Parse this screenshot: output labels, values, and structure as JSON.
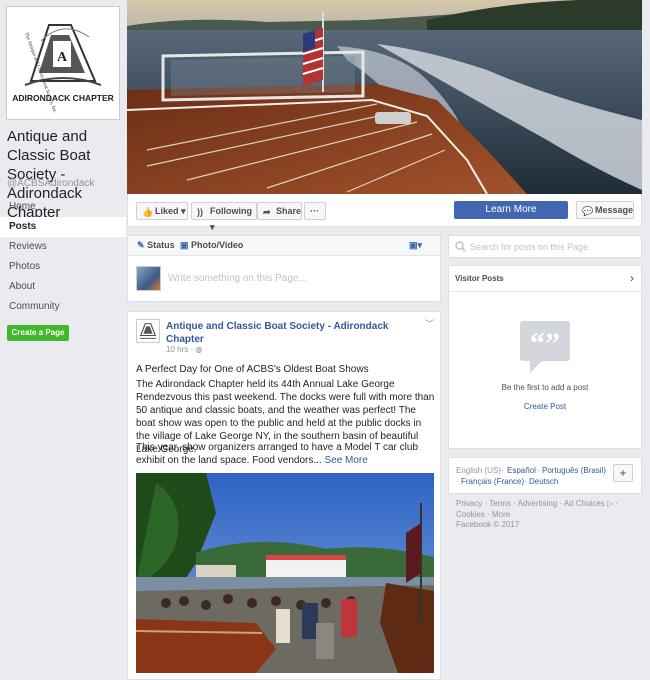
{
  "page": {
    "name": "Antique and Classic Boat Society - Adirondack Chapter",
    "handle": "@ACBSAdirondack",
    "logo_text_top": "The Antique and Classic Boat Society, Inc.",
    "logo_text_bottom": "ADIRONDACK CHAPTER"
  },
  "nav": {
    "items": [
      {
        "label": "Home"
      },
      {
        "label": "Posts"
      },
      {
        "label": "Reviews"
      },
      {
        "label": "Photos"
      },
      {
        "label": "About"
      },
      {
        "label": "Community"
      }
    ],
    "active": "Posts",
    "create_page": "Create a Page"
  },
  "actions": {
    "liked": "Liked",
    "following": "Following",
    "share": "Share",
    "more": "···",
    "learn_more": "Learn More",
    "message": "Message"
  },
  "composer": {
    "status": "Status",
    "photo_video": "Photo/Video",
    "placeholder": "Write something on this Page..."
  },
  "post": {
    "author": "Antique and Classic Boat Society - Adirondack Chapter",
    "time": "10 hrs ·",
    "headline": "A Perfect Day for One of ACBS's Oldest Boat Shows",
    "paragraph1": "The Adirondack Chapter held its 44th Annual Lake George Rendezvous this past weekend. The docks were full with more than 50 antique and classic boats, and the weather was perfect! The boat show was open to the public and held at the public docks in the village of Lake George NY, in the southern basin of beautiful Lake George.",
    "paragraph2": "This year, show organizers arranged to have a Model T car club exhibit on the land space. Food vendors...",
    "see_more": "See More"
  },
  "sidebar": {
    "search_placeholder": "Search for posts on this Page",
    "visitor_posts": "Visitor Posts",
    "visitor_empty": "Be the first to add a post",
    "create_post": "Create Post",
    "languages": [
      {
        "label": "English (US)",
        "current": true
      },
      {
        "label": "Español",
        "current": false
      },
      {
        "label": "Português (Brasil)",
        "current": false
      },
      {
        "label": "Français (France)",
        "current": false
      },
      {
        "label": "Deutsch",
        "current": false
      }
    ],
    "footer_line1": "Privacy · Terms · Advertising · Ad Choices",
    "footer_line2": "Cookies · More",
    "footer_line3": "Facebook © 2017"
  },
  "colors": {
    "brand": "#4267b2",
    "link": "#365899",
    "create_green": "#42b72a",
    "background": "#e9ebee"
  },
  "icons": {
    "liked": "thumbs-up-icon",
    "following": "rss-icon",
    "share": "share-arrow-icon",
    "message": "messenger-icon",
    "status": "pencil-icon",
    "photo": "photo-icon",
    "search": "search-icon",
    "visitor_empty": "quote-bubble-icon"
  }
}
